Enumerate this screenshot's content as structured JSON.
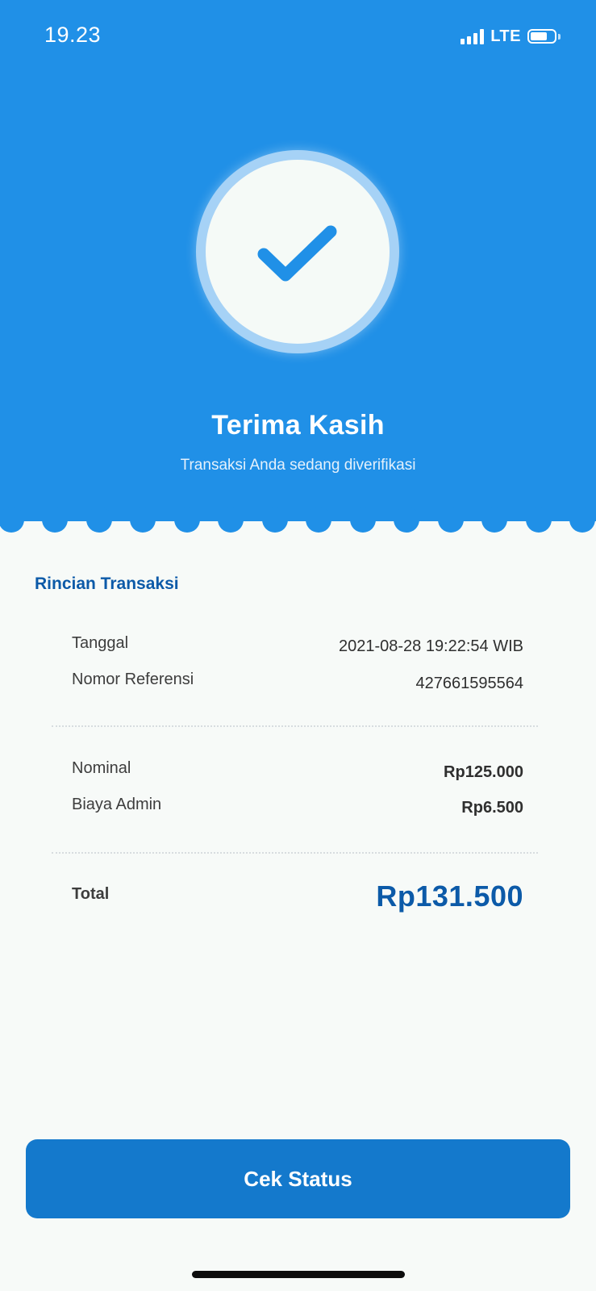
{
  "status_bar": {
    "time": "19.23",
    "network": "LTE",
    "icons": [
      "signal-bars-icon",
      "battery-icon"
    ]
  },
  "hero": {
    "icon": "check-icon",
    "title": "Terima Kasih",
    "subtitle": "Transaksi Anda sedang diverifikasi",
    "background_color": "#2090e7"
  },
  "details": {
    "title": "Rincian Transaksi",
    "rows": [
      {
        "label": "Tanggal",
        "value": "2021-08-28 19:22:54 WIB"
      },
      {
        "label": "Nomor Referensi",
        "value": "427661595564"
      },
      {
        "label": "Nominal",
        "value": "Rp125.000"
      },
      {
        "label": "Biaya Admin",
        "value": "Rp6.500"
      }
    ],
    "total_label": "Total",
    "total_value": "Rp131.500",
    "accent_color": "#0c5aa8"
  },
  "action": {
    "label": "Cek Status",
    "color": "#1479cc"
  }
}
